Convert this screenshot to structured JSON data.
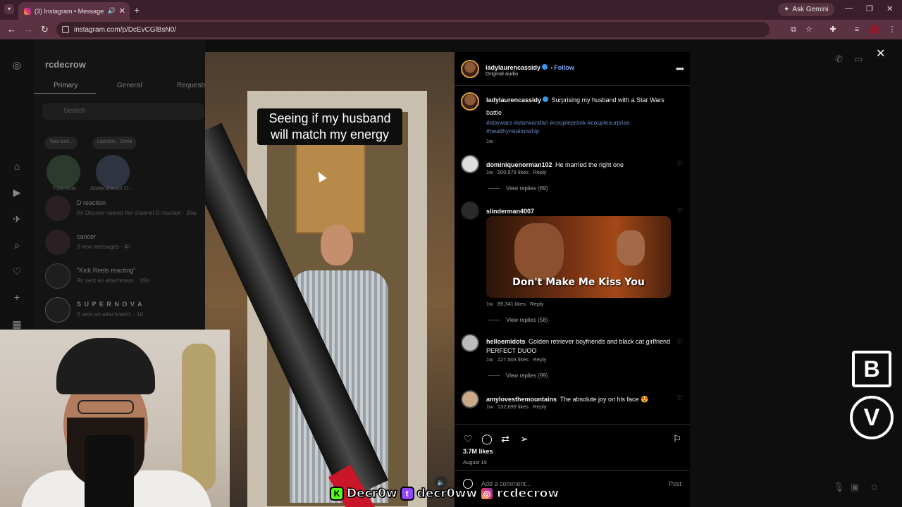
{
  "browser": {
    "tab_title": "(3) Instagram • Messages",
    "url": "instagram.com/p/DcEvCGlBsN0/",
    "gemini_label": "Ask Gemini"
  },
  "dm_panel": {
    "username": "rcdecrow",
    "tabs": [
      "Primary",
      "General",
      "Requests"
    ],
    "search_placeholder": "Search",
    "notes": [
      {
        "bubble": "Your turn...",
        "name": "Your note"
      },
      {
        "bubble": "Lancôm... Doria",
        "name": "Abderahman O..."
      }
    ],
    "conversations": [
      {
        "name": "D reaction",
        "sub": "Rc Decrow named the channel D reaction · 26w"
      },
      {
        "name": "cancer",
        "sub": "3 new messages · 4h"
      },
      {
        "name": "\"Kick Reels reacting\"",
        "sub": "Rc sent an attachment. · 15h"
      },
      {
        "name": "S U P E R N O V A",
        "sub": "S sent an attachment. · 1d"
      }
    ],
    "badge_count": "3"
  },
  "reel": {
    "caption": "Seeing if my husband will match my energy"
  },
  "post": {
    "author": "ladylaurencassidy",
    "follow_label": "Follow",
    "audio": "Original audio",
    "caption_text": "Surprising my husband with a Star Wars battle",
    "hashtags": "#starwars #starwarsfan #coupleprank #couplesurprise #healthyrelationship",
    "caption_time": "1w",
    "comments": [
      {
        "user": "dominiquenorman102",
        "text": "He married the right one",
        "time": "1w",
        "likes": "500,579 likes",
        "reply": "Reply",
        "replies": "View replies (69)"
      },
      {
        "user": "slinderman4007",
        "text": "",
        "gif_text": "Don't Make Me Kiss You",
        "time": "1w",
        "likes": "89,341 likes",
        "reply": "Reply",
        "replies": "View replies (58)"
      },
      {
        "user": "helloemidots",
        "text": "Golden retriever boyfriends and black cat girlfriend PERFECT DUOO",
        "time": "1w",
        "likes": "127,503 likes",
        "reply": "Reply",
        "replies": "View replies (99)"
      },
      {
        "user": "amylovesthemountains",
        "text": "The absolute joy on his face 😍",
        "time": "1w",
        "likes": "132,699 likes",
        "reply": "Reply"
      }
    ],
    "likes_total": "3.7M likes",
    "date": "August 15",
    "add_comment_placeholder": "Add a comment...",
    "post_button": "Post"
  },
  "overlay": {
    "social_1": "Decr0w",
    "social_2": "decr0ww",
    "social_3": "rcdecrow",
    "logo_top": "B",
    "logo_bottom": "V"
  },
  "icons": [
    "instagram-icon",
    "home-icon",
    "reels-icon",
    "messages-icon",
    "search-icon",
    "heart-icon",
    "plus-icon",
    "dashboard-icon",
    "phone-icon",
    "video-icon",
    "info-icon",
    "close-icon",
    "comment-icon",
    "share-icon",
    "repost-icon",
    "bookmark-icon",
    "emoji-icon",
    "mic-icon",
    "image-icon",
    "sticker-icon"
  ]
}
